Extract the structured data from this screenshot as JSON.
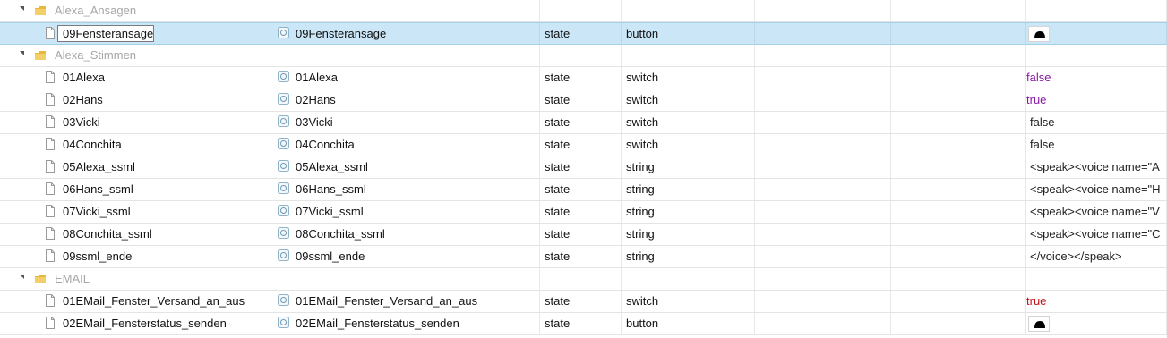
{
  "rows": [
    {
      "kind": "folder",
      "label": "Alexa_Ansagen"
    },
    {
      "kind": "item",
      "name": "09Fensteransage",
      "id": "09Fensteransage",
      "type": "state",
      "role": "button",
      "value_kind": "button",
      "selected": true
    },
    {
      "kind": "folder",
      "label": "Alexa_Stimmen"
    },
    {
      "kind": "item",
      "name": "01Alexa",
      "id": "01Alexa",
      "type": "state",
      "role": "switch",
      "value": "false",
      "value_style": "v-false-purple"
    },
    {
      "kind": "item",
      "name": "02Hans",
      "id": "02Hans",
      "type": "state",
      "role": "switch",
      "value": "true",
      "value_style": "v-true-purple"
    },
    {
      "kind": "item",
      "name": "03Vicki",
      "id": "03Vicki",
      "type": "state",
      "role": "switch",
      "value": "false",
      "value_style": "v-plain"
    },
    {
      "kind": "item",
      "name": "04Conchita",
      "id": "04Conchita",
      "type": "state",
      "role": "switch",
      "value": "false",
      "value_style": "v-plain"
    },
    {
      "kind": "item",
      "name": "05Alexa_ssml",
      "id": "05Alexa_ssml",
      "type": "state",
      "role": "string",
      "value": "<speak><voice name=\"A",
      "value_style": "v-plain"
    },
    {
      "kind": "item",
      "name": "06Hans_ssml",
      "id": "06Hans_ssml",
      "type": "state",
      "role": "string",
      "value": "<speak><voice name=\"H",
      "value_style": "v-plain"
    },
    {
      "kind": "item",
      "name": "07Vicki_ssml",
      "id": "07Vicki_ssml",
      "type": "state",
      "role": "string",
      "value": "<speak><voice name=\"V",
      "value_style": "v-plain"
    },
    {
      "kind": "item",
      "name": "08Conchita_ssml",
      "id": "08Conchita_ssml",
      "type": "state",
      "role": "string",
      "value": "<speak><voice name=\"C",
      "value_style": "v-plain"
    },
    {
      "kind": "item",
      "name": "09ssml_ende",
      "id": "09ssml_ende",
      "type": "state",
      "role": "string",
      "value": "</voice></speak>",
      "value_style": "v-plain"
    },
    {
      "kind": "folder",
      "label": "EMAIL"
    },
    {
      "kind": "item",
      "name": "01EMail_Fenster_Versand_an_aus",
      "id": "01EMail_Fenster_Versand_an_aus",
      "type": "state",
      "role": "switch",
      "value": "true",
      "value_style": "v-true-red"
    },
    {
      "kind": "item",
      "name": "02EMail_Fensterstatus_senden",
      "id": "02EMail_Fensterstatus_senden",
      "type": "state",
      "role": "button",
      "value_kind": "button"
    }
  ],
  "icons": {
    "expander": "triangle-down-icon",
    "folder": "folder-icon",
    "file": "file-icon",
    "state": "state-object-icon",
    "button": "bell-button-icon"
  },
  "colors": {
    "selection": "#cbe6f6",
    "folder_icon": "#e8b83a",
    "false_value": "#8a1aa6",
    "true_red": "#c0121a"
  }
}
